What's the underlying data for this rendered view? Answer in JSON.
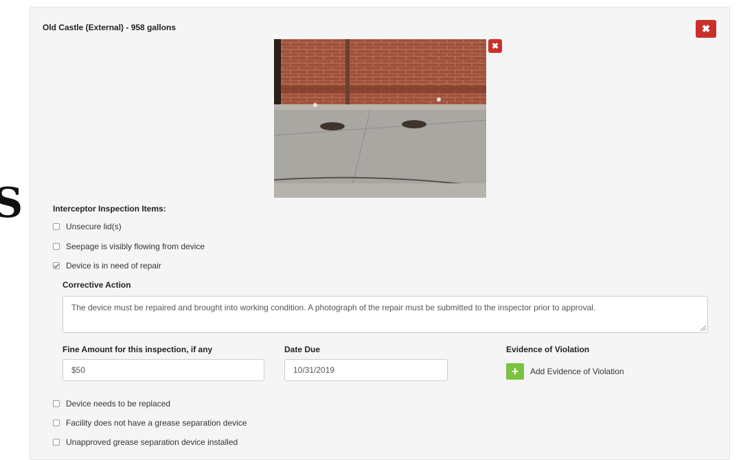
{
  "side_glyph": "S",
  "interceptor": {
    "title": "Old Castle (External) - 958 gallons",
    "remove_icon": "times-icon",
    "photo_remove_icon": "times-icon",
    "inspection_items_label": "Interceptor Inspection Items:",
    "items": [
      {
        "label": "Unsecure lid(s)",
        "checked": false
      },
      {
        "label": "Seepage is visibly flowing from device",
        "checked": false
      },
      {
        "label": "Device is in need of repair",
        "checked": true
      },
      {
        "label": "Device needs to be replaced",
        "checked": false
      },
      {
        "label": "Facility does not have a grease separation device",
        "checked": false
      },
      {
        "label": "Unapproved grease separation device installed",
        "checked": false
      }
    ],
    "corrective_action_label": "Corrective Action",
    "corrective_action_text": "The device must be repaired and brought into working condition. A photograph of the repair must be submitted to the inspector prior to approval.",
    "fine_label": "Fine Amount for this inspection, if any",
    "fine_value": "$50",
    "date_due_label": "Date Due",
    "date_due_value": "10/31/2019",
    "evidence_label": "Evidence of Violation",
    "add_evidence_label": "Add Evidence of Violation",
    "add_icon": "plus-icon"
  },
  "colors": {
    "danger": "#c9302c",
    "success": "#7cc243",
    "panel_bg": "#f5f5f5"
  }
}
